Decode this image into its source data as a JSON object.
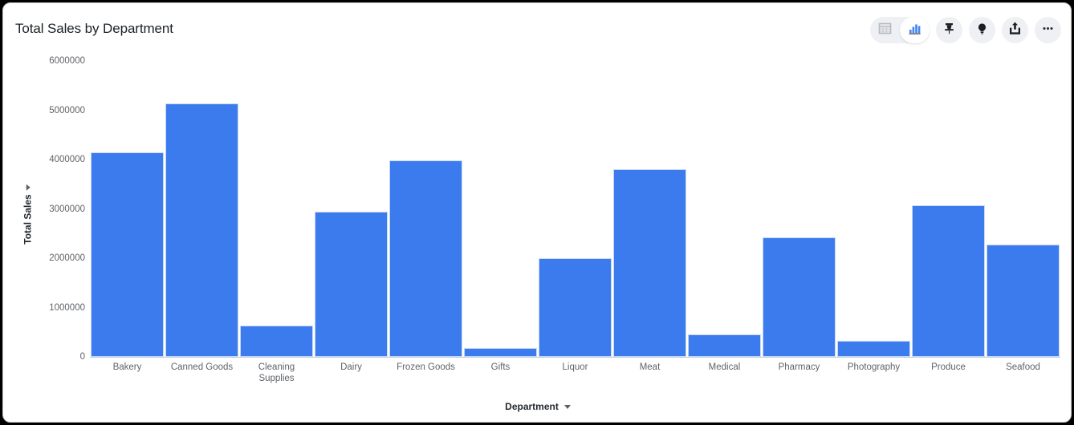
{
  "header": {
    "title": "Total Sales by Department"
  },
  "toolbar": {
    "view_toggle": [
      {
        "name": "table-view",
        "icon": "table-icon",
        "active": false
      },
      {
        "name": "chart-view",
        "icon": "bar-chart-icon",
        "active": true
      }
    ],
    "actions": [
      {
        "name": "pin-button",
        "icon": "pin-icon"
      },
      {
        "name": "insights-button",
        "icon": "lightbulb-icon"
      },
      {
        "name": "share-button",
        "icon": "share-upload-icon"
      },
      {
        "name": "more-button",
        "icon": "ellipsis-icon"
      }
    ]
  },
  "chart_data": {
    "type": "bar",
    "title": "Total Sales by Department",
    "xlabel": "Department",
    "ylabel": "Total Sales",
    "ylim": [
      0,
      6000000
    ],
    "ytick_labels": [
      "0",
      "1000000",
      "2000000",
      "3000000",
      "4000000",
      "5000000",
      "6000000"
    ],
    "yticks": [
      0,
      1000000,
      2000000,
      3000000,
      4000000,
      5000000,
      6000000
    ],
    "grid": false,
    "legend": null,
    "bar_color": "#3b7bee",
    "categories": [
      "Bakery",
      "Canned Goods",
      "Cleaning Supplies",
      "Dairy",
      "Frozen Goods",
      "Gifts",
      "Liquor",
      "Meat",
      "Medical",
      "Pharmacy",
      "Photography",
      "Produce",
      "Seafood"
    ],
    "values": [
      4150000,
      5140000,
      640000,
      2940000,
      3980000,
      175000,
      2000000,
      3800000,
      460000,
      2430000,
      330000,
      3070000,
      2280000
    ]
  }
}
